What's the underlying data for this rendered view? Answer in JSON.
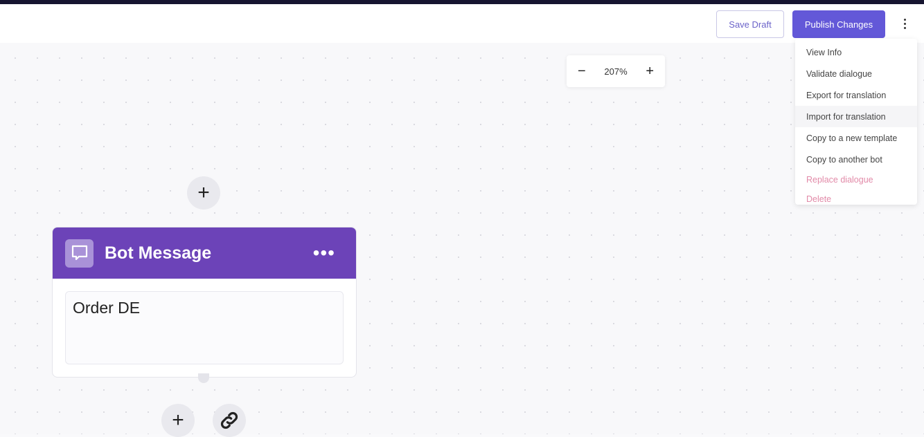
{
  "header": {
    "save_label": "Save Draft",
    "publish_label": "Publish Changes",
    "more_icon": "kebab-icon"
  },
  "menu": {
    "items": [
      "View Info",
      "Validate dialogue",
      "Export for translation",
      "Import for translation",
      "Copy to a new template",
      "Copy to another bot"
    ],
    "danger_items": [
      "Replace dialogue",
      "Delete"
    ],
    "danger_color": "#e28aa8"
  },
  "zoom": {
    "minus": "−",
    "value": "207%",
    "plus": "+"
  },
  "node": {
    "title": "Bot Message",
    "menu": "•••",
    "message": "Order DE",
    "header_color": "#6c43b8",
    "icon": "chat-bubble-icon"
  },
  "add": "+",
  "accent": "#6358d8"
}
